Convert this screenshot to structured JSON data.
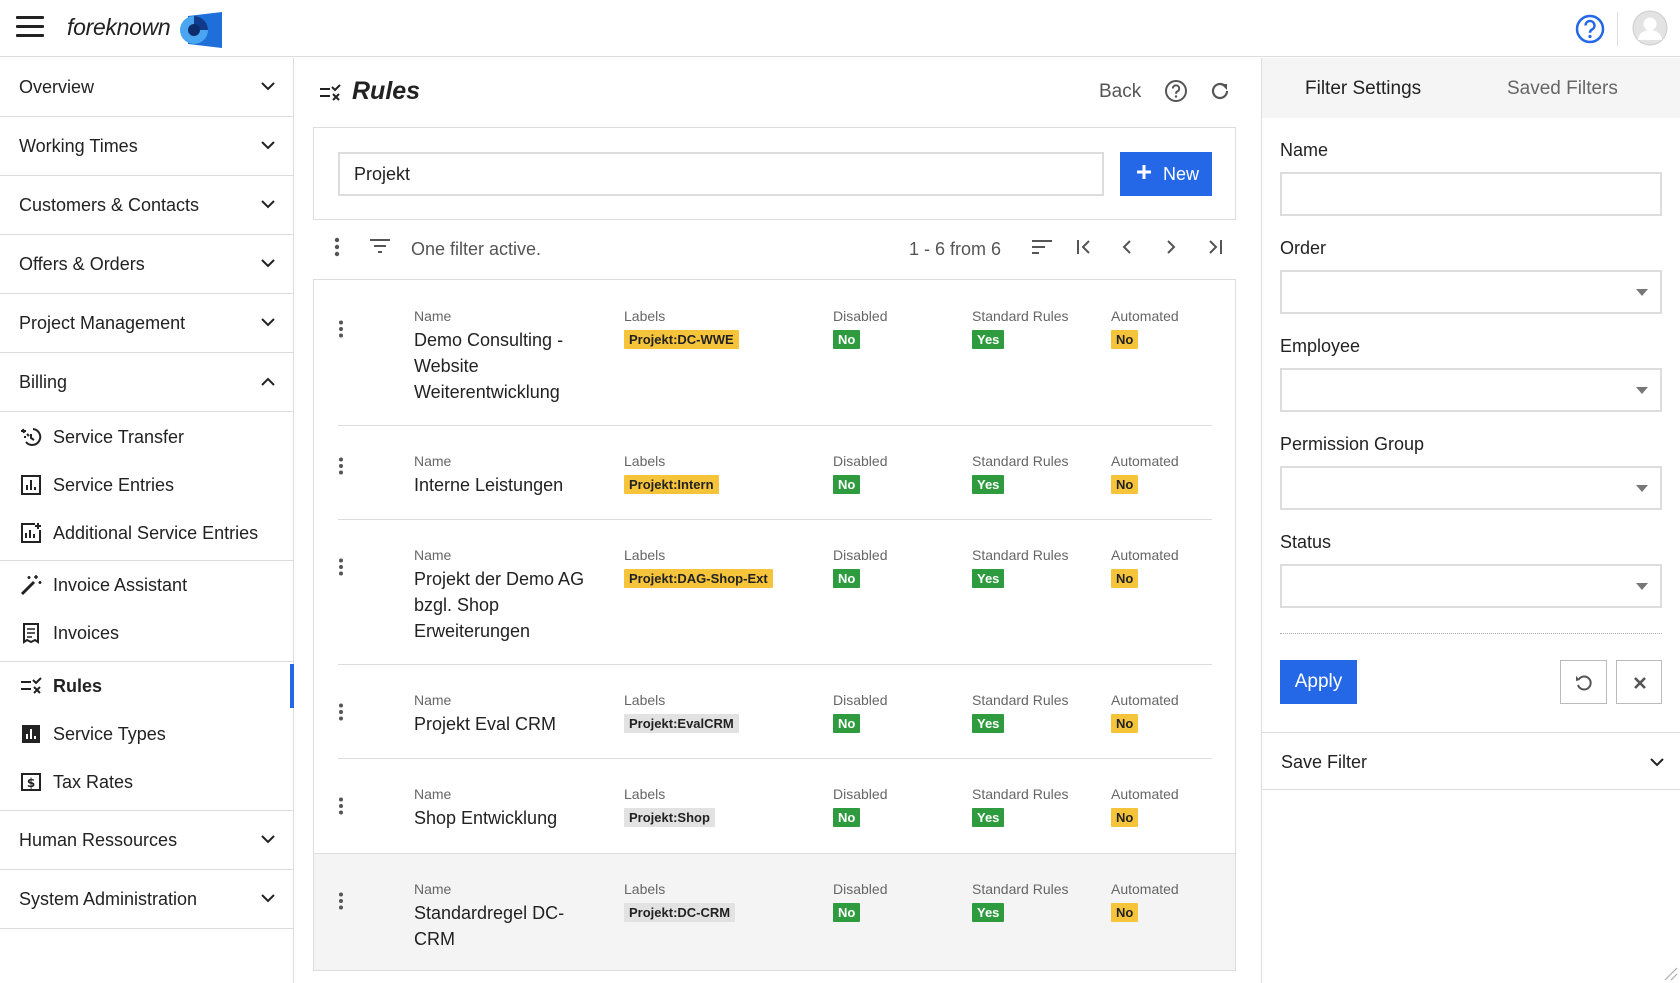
{
  "app": {
    "brand": "foreknown"
  },
  "sidebar": {
    "sections_top": [
      {
        "label": "Overview"
      },
      {
        "label": "Working Times"
      },
      {
        "label": "Customers & Contacts"
      },
      {
        "label": "Offers & Orders"
      },
      {
        "label": "Project Management"
      },
      {
        "label": "Billing"
      }
    ],
    "billing_items": [
      {
        "label": "Service Transfer",
        "icon": "service-transfer-icon"
      },
      {
        "label": "Service Entries",
        "icon": "chart-icon"
      },
      {
        "label": "Additional Service Entries",
        "icon": "chart-plus-icon"
      },
      {
        "label": "Invoice Assistant",
        "icon": "magic-wand-icon"
      },
      {
        "label": "Invoices",
        "icon": "receipt-icon"
      },
      {
        "label": "Rules",
        "icon": "rules-icon",
        "active": true
      },
      {
        "label": "Service Types",
        "icon": "bar-chart-icon"
      },
      {
        "label": "Tax Rates",
        "icon": "money-icon"
      }
    ],
    "sections_bottom": [
      {
        "label": "Human Ressources"
      },
      {
        "label": "System Administration"
      }
    ]
  },
  "main": {
    "title": "Rules",
    "back_label": "Back",
    "search": {
      "value": "Projekt"
    },
    "new_label": "New",
    "filter_status": "One filter active.",
    "page_range": "1 - 6 from 6",
    "column_labels": {
      "name": "Name",
      "labels": "Labels",
      "disabled": "Disabled",
      "standard_rules": "Standard Rules",
      "automated": "Automated"
    },
    "rows": [
      {
        "name": "Demo Consulting - Website Weiterentwicklung",
        "label": "Projekt:DC-WWE",
        "label_color": "yellow",
        "disabled": "No",
        "standard_rules": "Yes",
        "automated": "No"
      },
      {
        "name": "Interne Leistungen",
        "label": "Projekt:Intern",
        "label_color": "yellow",
        "disabled": "No",
        "standard_rules": "Yes",
        "automated": "No"
      },
      {
        "name": "Projekt der Demo AG bzgl. Shop Erweiterungen",
        "label": "Projekt:DAG-Shop-Ext",
        "label_color": "yellow",
        "disabled": "No",
        "standard_rules": "Yes",
        "automated": "No"
      },
      {
        "name": "Projekt Eval CRM",
        "label": "Projekt:EvalCRM",
        "label_color": "gray",
        "disabled": "No",
        "standard_rules": "Yes",
        "automated": "No"
      },
      {
        "name": "Shop Entwicklung",
        "label": "Projekt:Shop",
        "label_color": "gray",
        "disabled": "No",
        "standard_rules": "Yes",
        "automated": "No"
      },
      {
        "name": "Standardregel DC-CRM",
        "label": "Projekt:DC-CRM",
        "label_color": "gray",
        "disabled": "No",
        "standard_rules": "Yes",
        "automated": "No"
      }
    ]
  },
  "right_panel": {
    "tabs": [
      "Filter Settings",
      "Saved Filters"
    ],
    "fields": {
      "name": {
        "label": "Name",
        "value": ""
      },
      "order": {
        "label": "Order"
      },
      "employee": {
        "label": "Employee"
      },
      "permission_group": {
        "label": "Permission Group"
      },
      "status": {
        "label": "Status"
      }
    },
    "apply_label": "Apply",
    "save_filter_label": "Save Filter"
  },
  "colors": {
    "accent": "#2468e8",
    "badge_green": "#2e9b3e",
    "badge_amber": "#f6c43b",
    "tag_gray": "#e2e2e2"
  }
}
